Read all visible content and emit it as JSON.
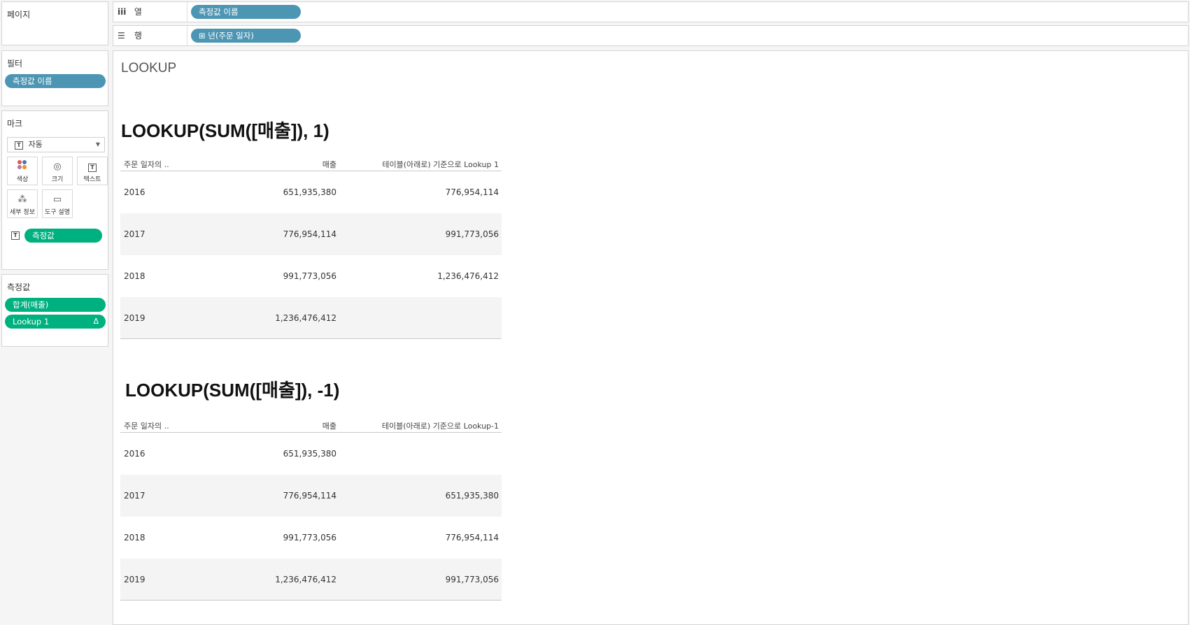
{
  "pages_panel": {
    "title": "페이지"
  },
  "filters_panel": {
    "title": "필터",
    "pills": [
      "측정값 이름"
    ]
  },
  "marks_panel": {
    "title": "마크",
    "mark_type": "자동",
    "buttons": {
      "color": "색상",
      "size": "크기",
      "text": "텍스트",
      "detail": "세부 정보",
      "tooltip": "도구 설명"
    },
    "text_pill": "측정값"
  },
  "measure_values_panel": {
    "title": "측정값",
    "pills": [
      "합계(매출)",
      "Lookup 1"
    ],
    "delta": "Δ"
  },
  "shelves": {
    "columns": {
      "label": "열",
      "pill": "측정값 이름"
    },
    "rows": {
      "label": "행",
      "pill": "⊞ 년(주문 일자)"
    }
  },
  "view": {
    "title": "LOOKUP",
    "table1": {
      "heading": "LOOKUP(SUM([매출]), 1)",
      "headers": [
        "주문 일자의 ..",
        "매출",
        "테이블(아래로) 기준으로 Lookup 1"
      ],
      "rows": [
        [
          "2016",
          "651,935,380",
          "776,954,114"
        ],
        [
          "2017",
          "776,954,114",
          "991,773,056"
        ],
        [
          "2018",
          "991,773,056",
          "1,236,476,412"
        ],
        [
          "2019",
          "1,236,476,412",
          ""
        ]
      ]
    },
    "table2": {
      "heading": "LOOKUP(SUM([매출]), -1)",
      "headers": [
        "주문 일자의 ..",
        "매출",
        "테이블(아래로) 기준으로 Lookup-1"
      ],
      "rows": [
        [
          "2016",
          "651,935,380",
          ""
        ],
        [
          "2017",
          "776,954,114",
          "651,935,380"
        ],
        [
          "2018",
          "991,773,056",
          "776,954,114"
        ],
        [
          "2019",
          "1,236,476,412",
          "991,773,056"
        ]
      ]
    }
  },
  "colors": {
    "dimension_pill": "#4c96b4",
    "measure_pill": "#00b180"
  }
}
